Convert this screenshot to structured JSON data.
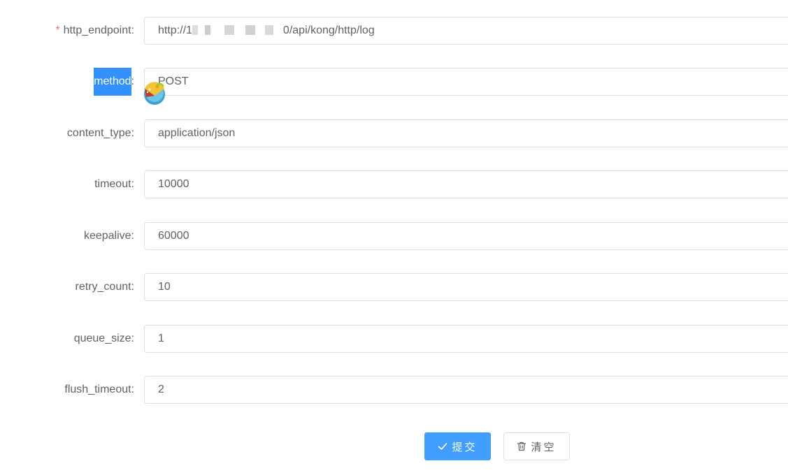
{
  "fields": [
    {
      "label": "http_endpoint:",
      "required_mark": "*",
      "value_prefix": "http://1",
      "value_suffix": "0/api/kong/http/log"
    },
    {
      "label_highlight": "method",
      "label_rest": ":",
      "value": "POST"
    },
    {
      "label": "content_type:",
      "value": "application/json"
    },
    {
      "label": "timeout:",
      "value": "10000"
    },
    {
      "label": "keepalive:",
      "value": "60000"
    },
    {
      "label": "retry_count:",
      "value": "10"
    },
    {
      "label": "queue_size:",
      "value": "1"
    },
    {
      "label": "flush_timeout:",
      "value": "2"
    }
  ],
  "buttons": {
    "submit_label": "提交",
    "clear_label": "清空"
  },
  "icons": {
    "submit": "check-icon",
    "clear": "trash-icon",
    "cursor": "overlay-cursor-icon"
  },
  "colors": {
    "primary": "#409eff",
    "required": "#f56c6c",
    "selection": "#3390ff",
    "border": "#dcdfe6",
    "text": "#606266"
  }
}
